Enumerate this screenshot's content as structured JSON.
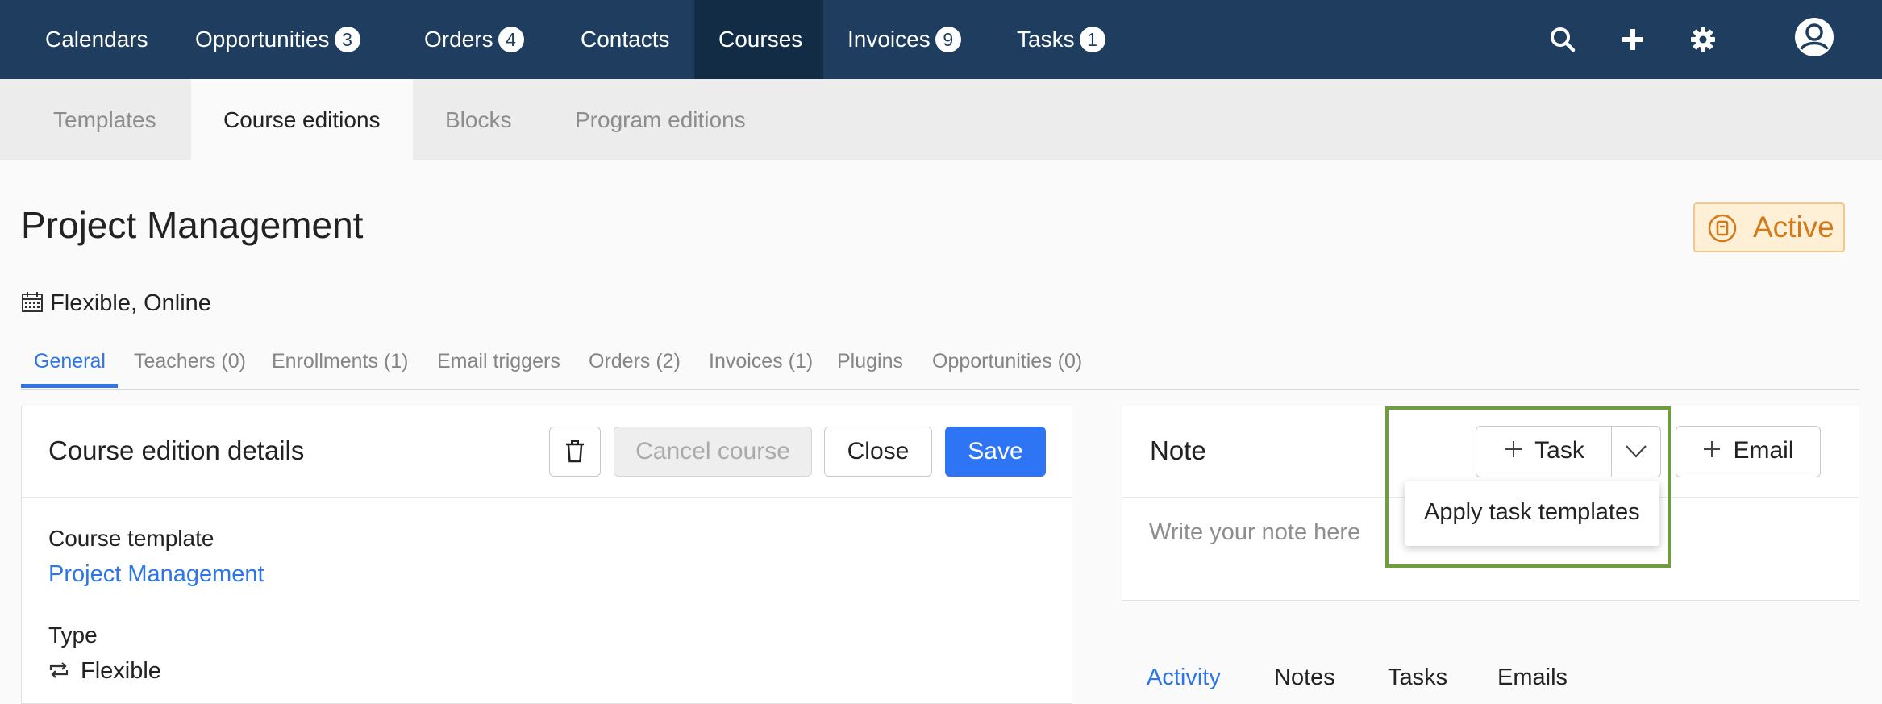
{
  "topnav": {
    "items": [
      {
        "label": "Calendars"
      },
      {
        "label": "Opportunities",
        "badge": "3"
      },
      {
        "label": "Orders",
        "badge": "4"
      },
      {
        "label": "Contacts"
      },
      {
        "label": "Courses"
      },
      {
        "label": "Invoices",
        "badge": "9"
      },
      {
        "label": "Tasks",
        "badge": "1"
      }
    ],
    "active": "Courses",
    "icons": [
      "search-icon",
      "plus-icon",
      "gear-icon",
      "user-avatar-icon"
    ]
  },
  "subtabs": {
    "items": [
      "Templates",
      "Course editions",
      "Blocks",
      "Program editions"
    ],
    "active": "Course editions"
  },
  "page": {
    "title": "Project Management",
    "status": "Active",
    "schedule": "Flexible, Online"
  },
  "content_tabs": {
    "items": [
      "General",
      "Teachers (0)",
      "Enrollments (1)",
      "Email triggers",
      "Orders (2)",
      "Invoices (1)",
      "Plugins",
      "Opportunities (0)"
    ],
    "active": "General"
  },
  "details_panel": {
    "title": "Course edition details",
    "buttons": {
      "cancel": "Cancel course",
      "close": "Close",
      "save": "Save"
    },
    "fields": {
      "template_label": "Course template",
      "template_value": "Project Management",
      "type_label": "Type",
      "type_value": "Flexible"
    }
  },
  "note_panel": {
    "title": "Note",
    "task_button": "Task",
    "email_button": "Email",
    "placeholder": "Write your note here",
    "dropdown_item": "Apply task templates"
  },
  "bottom_tabs": {
    "items": [
      "Activity",
      "Notes",
      "Tasks",
      "Emails"
    ],
    "active": "Activity"
  },
  "colors": {
    "nav_bg": "#1e3d5f",
    "nav_active": "#132c46",
    "accent": "#2e75e8",
    "status_text": "#d2791a",
    "status_bg": "#fdf0d6",
    "highlight": "#6f9c3c"
  }
}
